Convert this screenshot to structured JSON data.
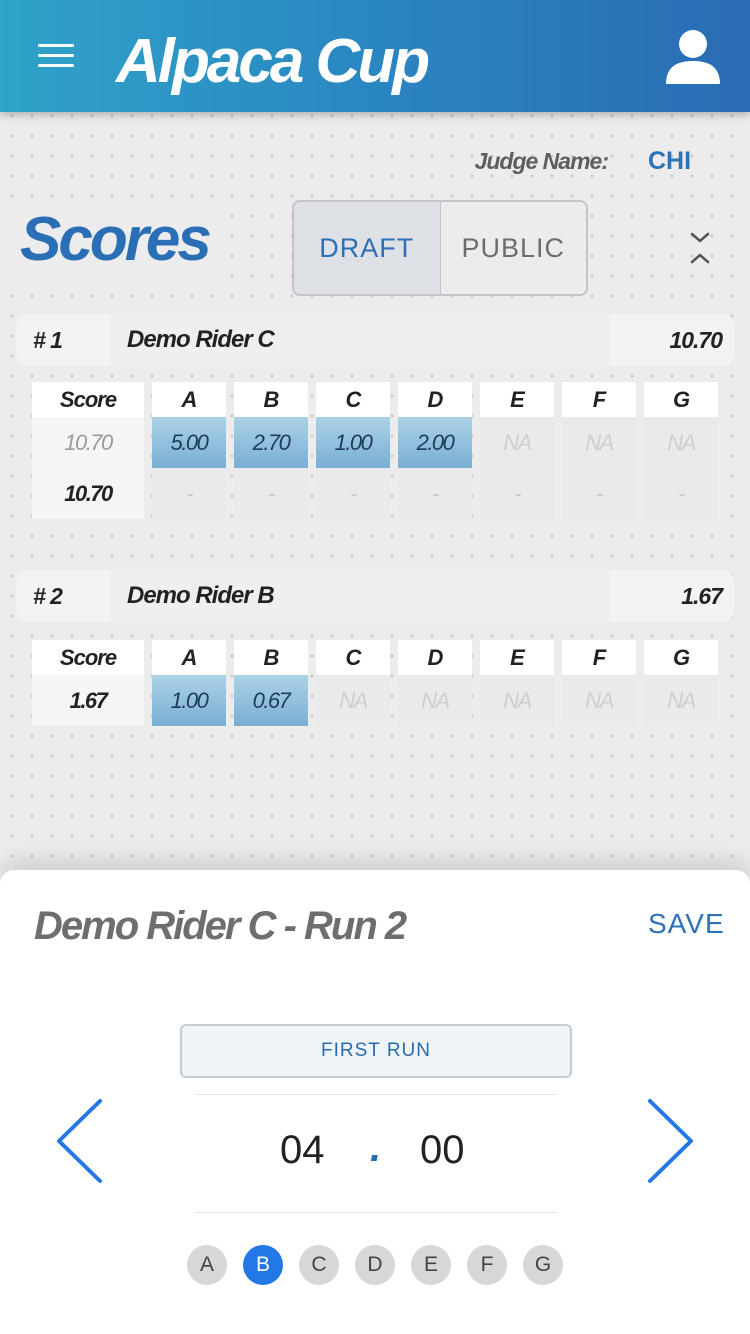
{
  "header": {
    "title": "Alpaca Cup"
  },
  "judge": {
    "label": "Judge Name:",
    "value": "CHI"
  },
  "page_title": "Scores",
  "segments": [
    {
      "label": "DRAFT",
      "active": true
    },
    {
      "label": "PUBLIC",
      "active": false
    }
  ],
  "riders": [
    {
      "number": "# 1",
      "name": "Demo Rider C",
      "total": "10.70",
      "headers": [
        "Score",
        "A",
        "B",
        "C",
        "D",
        "E",
        "F",
        "G"
      ],
      "runs": [
        {
          "score": "10.70",
          "cells": [
            "5.00",
            "2.70",
            "1.00",
            "2.00",
            "NA",
            "NA",
            "NA"
          ]
        },
        {
          "score": "10.70",
          "cells": [
            "-",
            "-",
            "-",
            "-",
            "-",
            "-",
            "-"
          ]
        }
      ]
    },
    {
      "number": "# 2",
      "name": "Demo Rider B",
      "total": "1.67",
      "headers": [
        "Score",
        "A",
        "B",
        "C",
        "D",
        "E",
        "F",
        "G"
      ],
      "runs": [
        {
          "score": "1.67",
          "cells": [
            "1.00",
            "0.67",
            "NA",
            "NA",
            "NA",
            "NA",
            "NA"
          ]
        }
      ]
    }
  ],
  "sheet": {
    "title": "Demo Rider C - Run 2",
    "save_label": "SAVE",
    "first_run_label": "FIRST RUN",
    "time": {
      "minutes": "04",
      "separator": ".",
      "seconds": "00"
    },
    "judges": [
      "A",
      "B",
      "C",
      "D",
      "E",
      "F",
      "G"
    ],
    "active_judge": "B"
  },
  "colors": {
    "accent": "#2a6fb6",
    "active_dot": "#2478e6",
    "cell_fill": "#8fbcdc"
  }
}
